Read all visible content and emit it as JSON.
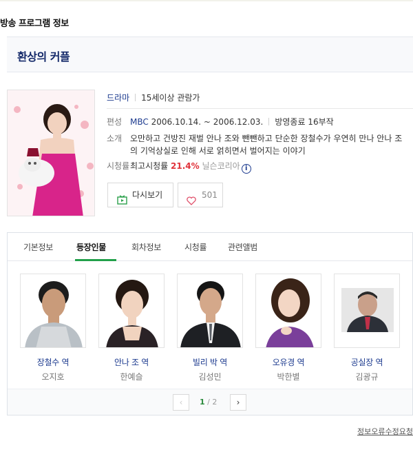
{
  "section_title": "방송 프로그램 정보",
  "program": {
    "title": "환상의 커플",
    "genre": "드라마",
    "age_rating": "15세이상 관람가",
    "broadcast_label": "편성",
    "broadcaster": "MBC",
    "dates": "2006.10.14. ~ 2006.12.03.",
    "status": "방영종료 16부작",
    "intro_label": "소개",
    "intro": "오만하고 건방진 재벌 안나 조와 뺀뺀하고 단순한 장철수가 우연히 만나 안나 조의 기억상실로 인해 서로 얽히면서 벌어지는 이야기",
    "viewership_label": "시청률",
    "max_viewership_label": "최고시청률",
    "max_viewership_value": "21.4%",
    "viewership_source": "닐슨코리아",
    "info_icon": "i"
  },
  "buttons": {
    "replay": "다시보기",
    "like_count": "501"
  },
  "tabs": [
    "기본정보",
    "등장인물",
    "회차정보",
    "시청률",
    "관련앨범"
  ],
  "active_tab": "등장인물",
  "cast": [
    {
      "role": "장철수 역",
      "actor": "오지호"
    },
    {
      "role": "안나 조 역",
      "actor": "한예슬"
    },
    {
      "role": "빌리 박 역",
      "actor": "김성민"
    },
    {
      "role": "오유경 역",
      "actor": "박한별"
    },
    {
      "role": "공실장 역",
      "actor": "김광규"
    }
  ],
  "pagination": {
    "current": "1",
    "separator": "/",
    "total": "2",
    "prev": "‹",
    "next": "›"
  },
  "report_link": "정보오류수정요청"
}
